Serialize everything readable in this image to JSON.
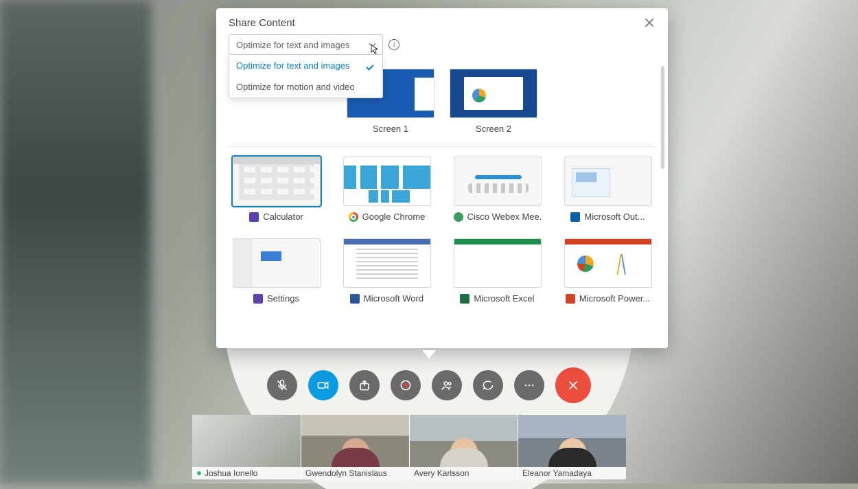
{
  "dialog": {
    "title": "Share Content",
    "dropdown": {
      "selected": "Optimize for text and images",
      "options": [
        {
          "label": "Optimize for text and images",
          "selected": true
        },
        {
          "label": "Optimize for motion and video",
          "selected": false
        }
      ]
    },
    "screens": [
      {
        "label": "Screen 1"
      },
      {
        "label": "Screen 2"
      }
    ],
    "apps": [
      {
        "label": "Calculator",
        "icon": "calc",
        "thumb": "calc",
        "selected": true
      },
      {
        "label": "Google Chrome",
        "icon": "chrome",
        "thumb": "chrome"
      },
      {
        "label": "Cisco Webex Mee...",
        "icon": "webex",
        "thumb": "webex"
      },
      {
        "label": "Microsoft Out...",
        "icon": "outlook",
        "thumb": "outlook"
      },
      {
        "label": "Settings",
        "icon": "settings",
        "thumb": "settings"
      },
      {
        "label": "Microsoft Word",
        "icon": "word",
        "thumb": "word"
      },
      {
        "label": "Microsoft Excel",
        "icon": "excel",
        "thumb": "excel"
      },
      {
        "label": "Microsoft Power...",
        "icon": "ppt",
        "thumb": "ppt"
      }
    ]
  },
  "controls": {
    "mute": "mute-button",
    "video": "video-button",
    "share": "share-button",
    "record": "record-button",
    "participants": "participants-button",
    "chat": "chat-button",
    "more": "more-button",
    "hangup": "hangup-button"
  },
  "participants": [
    {
      "name": "Joshua Ionello",
      "self": true
    },
    {
      "name": "Gwendolyn Stanislaus"
    },
    {
      "name": "Avery Karlsson"
    },
    {
      "name": "Eleanor Yamadaya"
    }
  ]
}
